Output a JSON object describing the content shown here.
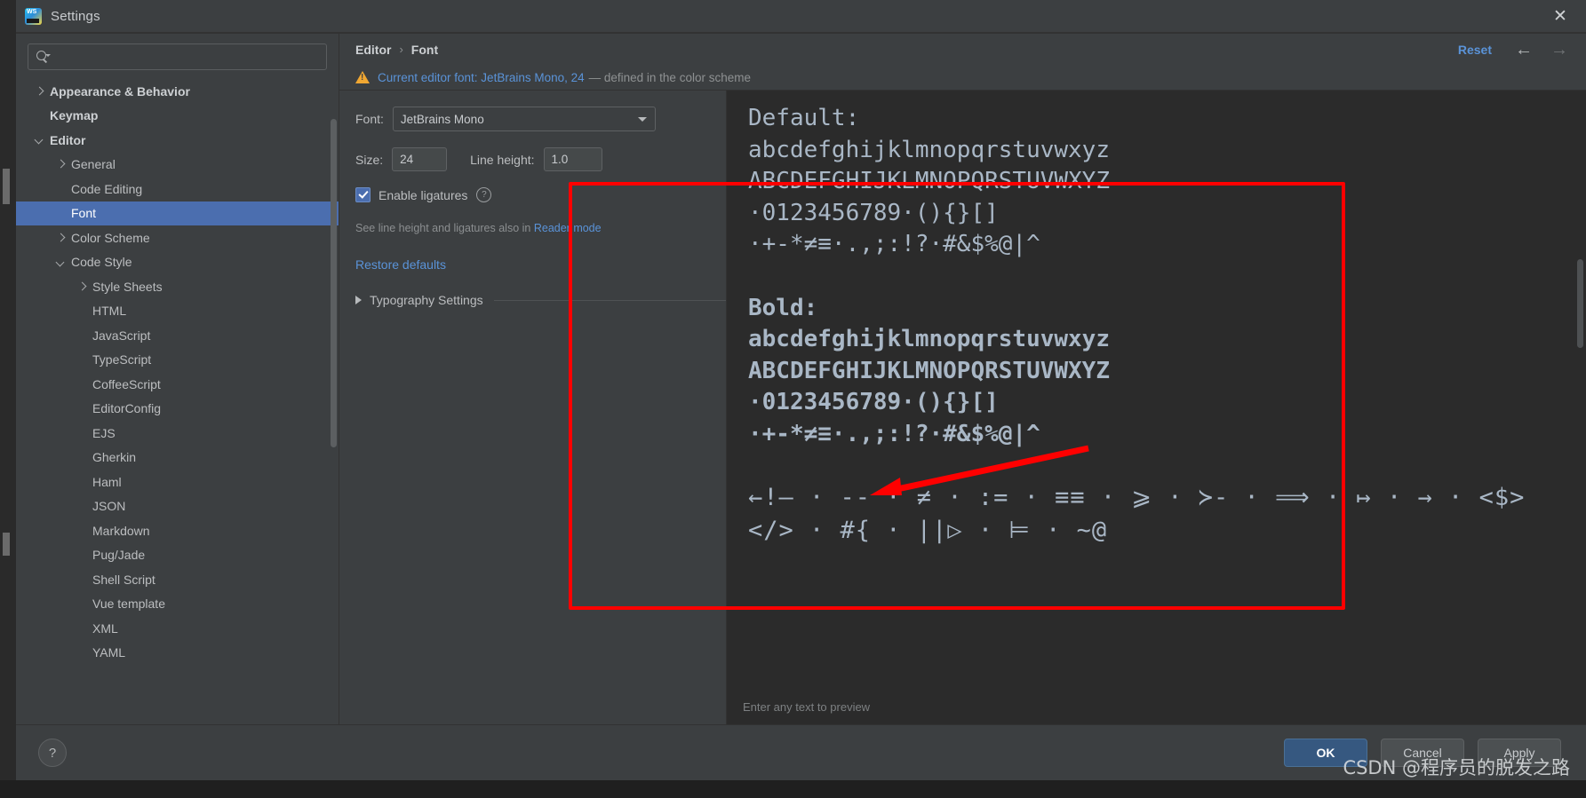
{
  "window": {
    "title": "Settings",
    "app_icon": "webstorm-icon",
    "close_icon": "close-icon"
  },
  "search": {
    "value": "",
    "placeholder": "",
    "icon": "search-icon"
  },
  "sidebar": {
    "items": [
      {
        "label": "Appearance & Behavior",
        "indent": 0,
        "twisty": "right",
        "bold": true,
        "selected": false
      },
      {
        "label": "Keymap",
        "indent": 0,
        "twisty": "none",
        "bold": true,
        "selected": false
      },
      {
        "label": "Editor",
        "indent": 0,
        "twisty": "down",
        "bold": true,
        "selected": false
      },
      {
        "label": "General",
        "indent": 1,
        "twisty": "right",
        "bold": false,
        "selected": false
      },
      {
        "label": "Code Editing",
        "indent": 1,
        "twisty": "none",
        "bold": false,
        "selected": false
      },
      {
        "label": "Font",
        "indent": 1,
        "twisty": "none",
        "bold": false,
        "selected": true
      },
      {
        "label": "Color Scheme",
        "indent": 1,
        "twisty": "right",
        "bold": false,
        "selected": false
      },
      {
        "label": "Code Style",
        "indent": 1,
        "twisty": "down",
        "bold": false,
        "selected": false
      },
      {
        "label": "Style Sheets",
        "indent": 2,
        "twisty": "right",
        "bold": false,
        "selected": false
      },
      {
        "label": "HTML",
        "indent": 2,
        "twisty": "none",
        "bold": false,
        "selected": false
      },
      {
        "label": "JavaScript",
        "indent": 2,
        "twisty": "none",
        "bold": false,
        "selected": false
      },
      {
        "label": "TypeScript",
        "indent": 2,
        "twisty": "none",
        "bold": false,
        "selected": false
      },
      {
        "label": "CoffeeScript",
        "indent": 2,
        "twisty": "none",
        "bold": false,
        "selected": false
      },
      {
        "label": "EditorConfig",
        "indent": 2,
        "twisty": "none",
        "bold": false,
        "selected": false
      },
      {
        "label": "EJS",
        "indent": 2,
        "twisty": "none",
        "bold": false,
        "selected": false
      },
      {
        "label": "Gherkin",
        "indent": 2,
        "twisty": "none",
        "bold": false,
        "selected": false
      },
      {
        "label": "Haml",
        "indent": 2,
        "twisty": "none",
        "bold": false,
        "selected": false
      },
      {
        "label": "JSON",
        "indent": 2,
        "twisty": "none",
        "bold": false,
        "selected": false
      },
      {
        "label": "Markdown",
        "indent": 2,
        "twisty": "none",
        "bold": false,
        "selected": false
      },
      {
        "label": "Pug/Jade",
        "indent": 2,
        "twisty": "none",
        "bold": false,
        "selected": false
      },
      {
        "label": "Shell Script",
        "indent": 2,
        "twisty": "none",
        "bold": false,
        "selected": false
      },
      {
        "label": "Vue template",
        "indent": 2,
        "twisty": "none",
        "bold": false,
        "selected": false
      },
      {
        "label": "XML",
        "indent": 2,
        "twisty": "none",
        "bold": false,
        "selected": false
      },
      {
        "label": "YAML",
        "indent": 2,
        "twisty": "none",
        "bold": false,
        "selected": false
      }
    ]
  },
  "header": {
    "breadcrumb_parent": "Editor",
    "breadcrumb_sep": "›",
    "breadcrumb_current": "Font",
    "reset_label": "Reset",
    "back_icon": "arrow-left-icon",
    "forward_icon": "arrow-right-icon"
  },
  "notice": {
    "icon": "warning-icon",
    "link_text": "Current editor font: JetBrains Mono, 24",
    "rest_text": "— defined in the color scheme"
  },
  "settings": {
    "font_label": "Font:",
    "font_value": "JetBrains Mono",
    "size_label": "Size:",
    "size_value": "24",
    "line_height_label": "Line height:",
    "line_height_value": "1.0",
    "ligatures_label": "Enable ligatures",
    "ligatures_checked": true,
    "help_glyph": "?",
    "hint_text": "See line height and ligatures also in",
    "hint_link": "Reader mode",
    "restore_label": "Restore defaults",
    "typography_label": "Typography Settings"
  },
  "preview": {
    "default_heading": "Default:",
    "default_lower": "abcdefghijklmnopqrstuvwxyz",
    "default_upper": "ABCDEFGHIJKLMNOPQRSTUVWXYZ",
    "default_digits": "·0123456789·(){}[]",
    "default_symbols": "·+-*≠≡·.,;:!?·#&$%@|^",
    "bold_heading": "Bold:",
    "bold_lower": "abcdefghijklmnopqrstuvwxyz",
    "bold_upper": "ABCDEFGHIJKLMNOPQRSTUVWXYZ",
    "bold_digits": "·0123456789·(){}[]",
    "bold_symbols": "·+-*≠≡·.,;:!?·#&$%@|^",
    "ligature_row_1": "←!— · -- · ≠ · := · ≡≡ · ⩾ · ≻- · ⟹ · ↦ · → · <$>",
    "ligature_row_2": "</> · #{ · ||▷ · ⊨ · ~@",
    "footer_hint": "Enter any text to preview"
  },
  "footer": {
    "help_icon": "help-icon",
    "ok_label": "OK",
    "cancel_label": "Cancel",
    "apply_label": "Apply"
  },
  "annotations": {
    "highlight_color": "#ff0000",
    "watermark": "CSDN @程序员的脱发之路"
  }
}
